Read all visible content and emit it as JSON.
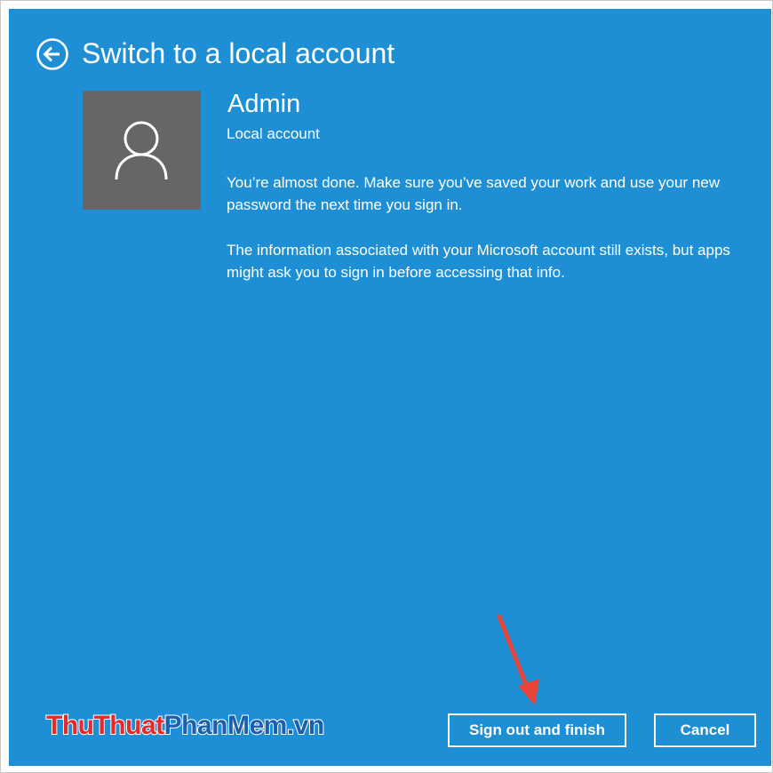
{
  "header": {
    "title": "Switch to a local account",
    "back_icon": "back-arrow-circle-icon"
  },
  "account": {
    "name": "Admin",
    "type": "Local account",
    "avatar_icon": "user-silhouette-icon"
  },
  "messages": [
    "You’re almost done. Make sure you’ve saved your work and use your new password the next time you sign in.",
    "The information associated with your Microsoft account still exists, but apps might ask you to sign in before accessing that info."
  ],
  "buttons": {
    "sign_out": "Sign out and finish",
    "cancel": "Cancel"
  },
  "watermark": {
    "part1": "ThuThuat",
    "part2": "PhanMem.vn"
  },
  "colors": {
    "background": "#1e8fd5",
    "avatar_bg": "#666666",
    "arrow": "#e8443a",
    "text": "#ffffff"
  }
}
